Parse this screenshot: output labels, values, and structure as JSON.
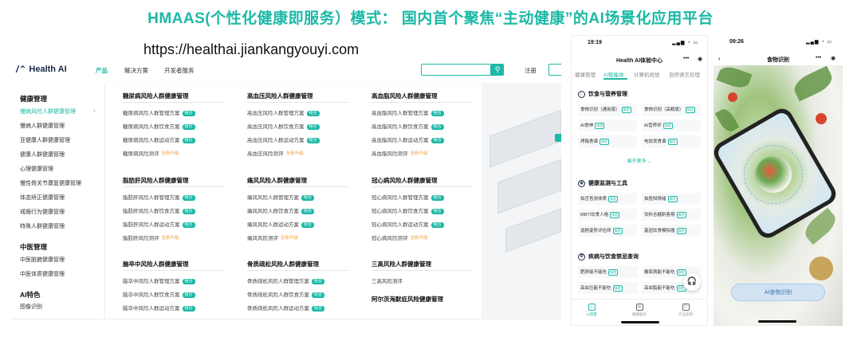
{
  "headline": "HMAAS(个性化健康即服务）模式： 国内首个聚焦“主动健康”的AI场景化应用平台",
  "url": "https://healthai.jiankangyouyi.com",
  "desktop": {
    "logo": "Health AI",
    "nav": [
      "产品",
      "解决方案",
      "开发者服务"
    ],
    "search_icon": "search-icon",
    "login": "注册",
    "sidebar": {
      "sections": [
        {
          "title": "健康管理",
          "items": [
            "慢病风险人群健康管理",
            "慢病人群健康管理",
            "亚健康人群健康管理",
            "健康人群健康管理",
            "心理健康管理",
            "慢性骨关节康复健康管理",
            "体态矫正健康管理",
            "戒瘾行为健康管理",
            "特殊人群健康管理"
          ]
        },
        {
          "title": "中医管理",
          "items": [
            "中医脏腑健康管理",
            "中医体质健康管理"
          ]
        },
        {
          "title": "AI特色",
          "items": [
            "图像识别"
          ]
        }
      ]
    },
    "groups": [
      {
        "title": "糖尿病风险人群健康管理",
        "items": [
          {
            "label": "糖尿病风险人群管理方案",
            "tag": "组合"
          },
          {
            "label": "糖尿病风险人群饮食方案",
            "tag": "组合"
          },
          {
            "label": "糖尿病风险人群运动方案",
            "tag": "组合"
          },
          {
            "label": "糖尿病风险测评",
            "tag": "全新升级"
          }
        ]
      },
      {
        "title": "高血压风险人群健康管理",
        "items": [
          {
            "label": "高血压风险人群管理方案",
            "tag": "组合"
          },
          {
            "label": "高血压风险人群饮食方案",
            "tag": "组合"
          },
          {
            "label": "高血压风险人群运动方案",
            "tag": "组合"
          },
          {
            "label": "高血压风险测评",
            "tag": "全新升级"
          }
        ]
      },
      {
        "title": "高血脂风险人群健康管理",
        "items": [
          {
            "label": "高血脂风险人群管理方案",
            "tag": "组合"
          },
          {
            "label": "高血脂风险人群饮食方案",
            "tag": "组合"
          },
          {
            "label": "高血脂风险人群运动方案",
            "tag": "组合"
          },
          {
            "label": "高血脂风险测评",
            "tag": "全新升级"
          }
        ]
      },
      {
        "title": "脂肪肝风险人群健康管理",
        "items": [
          {
            "label": "脂肪肝风险人群管理方案",
            "tag": "组合"
          },
          {
            "label": "脂肪肝风险人群饮食方案",
            "tag": "组合"
          },
          {
            "label": "脂肪肝风险人群运动方案",
            "tag": "组合"
          },
          {
            "label": "脂肪肝风险测评",
            "tag": "全新升级"
          }
        ]
      },
      {
        "title": "痛风风险人群健康管理",
        "items": [
          {
            "label": "痛风风险人群管理方案",
            "tag": "组合"
          },
          {
            "label": "痛风风险人群饮食方案",
            "tag": "组合"
          },
          {
            "label": "痛风风险人群运动方案",
            "tag": "组合"
          },
          {
            "label": "痛风风险测评",
            "tag": "全新升级"
          }
        ]
      },
      {
        "title": "冠心病风险人群健康管理",
        "items": [
          {
            "label": "冠心病风险人群管理方案",
            "tag": "组合"
          },
          {
            "label": "冠心病风险人群饮食方案",
            "tag": "组合"
          },
          {
            "label": "冠心病风险人群运动方案",
            "tag": "组合"
          },
          {
            "label": "冠心病风险测评",
            "tag": "全新升级"
          }
        ]
      },
      {
        "title": "脑卒中风险人群健康管理",
        "items": [
          {
            "label": "脑卒中风险人群管理方案",
            "tag": "组合"
          },
          {
            "label": "脑卒中风险人群饮食方案",
            "tag": "组合"
          },
          {
            "label": "脑卒中风险人群运动方案",
            "tag": "组合"
          }
        ]
      },
      {
        "title": "骨质疏松风险人群健康管理",
        "items": [
          {
            "label": "骨质疏松风险人群管理方案",
            "tag": "组合"
          },
          {
            "label": "骨质疏松风险人群饮食方案",
            "tag": "组合"
          },
          {
            "label": "骨质疏松风险人群运动方案",
            "tag": "组合"
          }
        ]
      },
      {
        "title": "三高风险人群健康管理",
        "items": [
          {
            "label": "三高风险测评",
            "tag": ""
          }
        ]
      }
    ],
    "extra_group_title": "阿尔茨海默症风险健康管理"
  },
  "phone1": {
    "time": "19:19",
    "title": "Health AI体验中心",
    "tabs": [
      "健康管理",
      "AI智能体",
      "计算机视觉",
      "自然语言处理"
    ],
    "active_tab": 1,
    "sections": [
      {
        "title": "饮食与营养管理",
        "icon": "fork-icon",
        "cards": [
          {
            "label": "食物识别（通用版）",
            "tag": "体验"
          },
          {
            "label": "食物识别（高精版）",
            "tag": "体验"
          },
          {
            "label": "AI食神",
            "tag": "体验"
          },
          {
            "label": "AI营养师",
            "tag": "体验"
          },
          {
            "label": "烤箱食谱",
            "tag": "体验"
          },
          {
            "label": "电饭煲食谱",
            "tag": "体验"
          }
        ]
      },
      {
        "title": "健康监测与工具",
        "icon": "monitor-icon",
        "cards": [
          {
            "label": "拍舌苔测体质",
            "tag": "体验"
          },
          {
            "label": "拍脸知情绪",
            "tag": "体验"
          },
          {
            "label": "MBTI饮食人格",
            "tag": "体验"
          },
          {
            "label": "饮料含糖刺客榜",
            "tag": "体验"
          },
          {
            "label": "追剧姿势评估师",
            "tag": "体验"
          },
          {
            "label": "基因饮食模拟器",
            "tag": "体验"
          }
        ]
      },
      {
        "title": "疾病与饮食禁忌查询",
        "icon": "shield-icon",
        "cards": [
          {
            "label": "肥胖能不能吃",
            "tag": "体验"
          },
          {
            "label": "糖尿病能不能吃",
            "tag": "体验"
          },
          {
            "label": "高血压能不能吃",
            "tag": "体验"
          },
          {
            "label": "高血脂能不能吃",
            "tag": "体验"
          }
        ]
      }
    ],
    "more": "展开更多",
    "bottom_nav": [
      "AI测量",
      "健康服务",
      "行业案例"
    ]
  },
  "phone2": {
    "time": "09:26",
    "title": "食物识别",
    "button": "AI食物识别"
  }
}
